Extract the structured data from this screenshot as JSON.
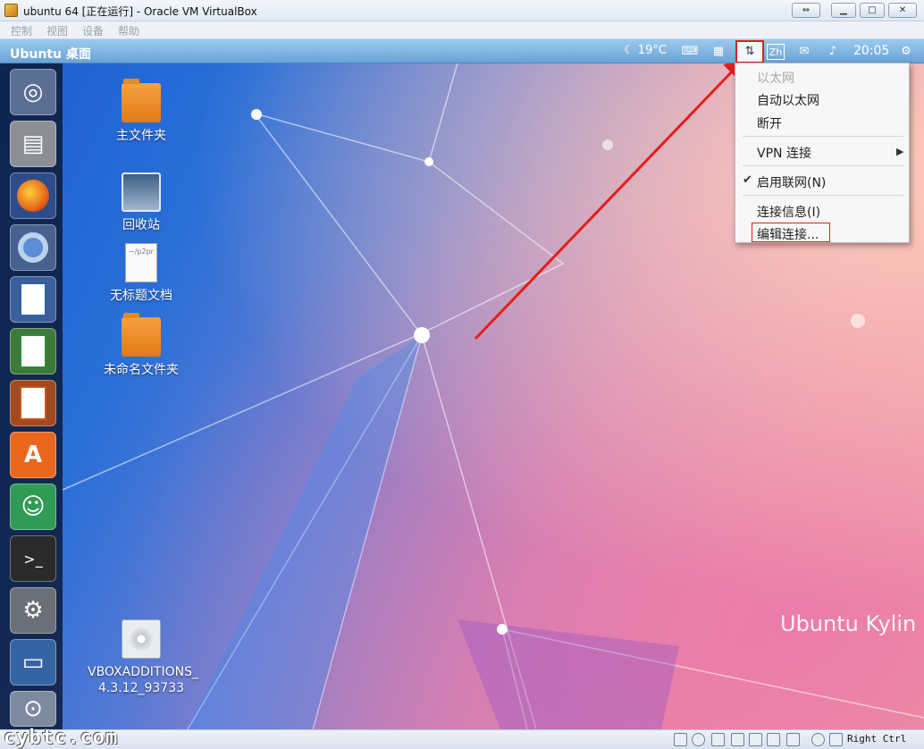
{
  "window": {
    "title": "ubuntu 64 [正在运行] - Oracle VM VirtualBox",
    "menu": [
      "控制",
      "视图",
      "设备",
      "帮助"
    ]
  },
  "panel": {
    "title": "Ubuntu 桌面",
    "weather": "19°C",
    "clock": "20:05",
    "input_method": "Zh"
  },
  "launcher": {
    "items": [
      "ubuntu-dash",
      "files",
      "firefox",
      "chromium",
      "libreoffice-writer",
      "libreoffice-calc",
      "libreoffice-impress",
      "software-center",
      "kylin-assistant",
      "terminal",
      "system-settings",
      "screenshot",
      "workspaces"
    ]
  },
  "desktop": {
    "icons": [
      {
        "label": "主文件夹",
        "icon": "home-folder-icon"
      },
      {
        "label": "回收站",
        "icon": "trash-icon"
      },
      {
        "label": "无标题文档",
        "icon": "document-icon",
        "badge": "~/p2pr"
      },
      {
        "label": "未命名文件夹",
        "icon": "folder-icon"
      },
      {
        "label": "VBOXADDITIONS_\n4.3.12_93733",
        "icon": "cd-icon"
      }
    ],
    "wallpaper_text": "Ubuntu Kylin"
  },
  "network_menu": {
    "items": [
      {
        "label": "以太网",
        "disabled": true
      },
      {
        "label": "自动以太网"
      },
      {
        "label": "断开"
      },
      {
        "label": "VPN 连接",
        "submenu": true
      },
      {
        "label": "启用联网(N)",
        "checked": true
      },
      {
        "label": "连接信息(I)"
      },
      {
        "label": "编辑连接...",
        "highlighted": true
      }
    ]
  },
  "statusbar": {
    "watermark": "cybtc.com",
    "host_key": "Right Ctrl"
  },
  "colors": {
    "annotation": "#e41d1d",
    "panel": "#7fb3e0"
  }
}
